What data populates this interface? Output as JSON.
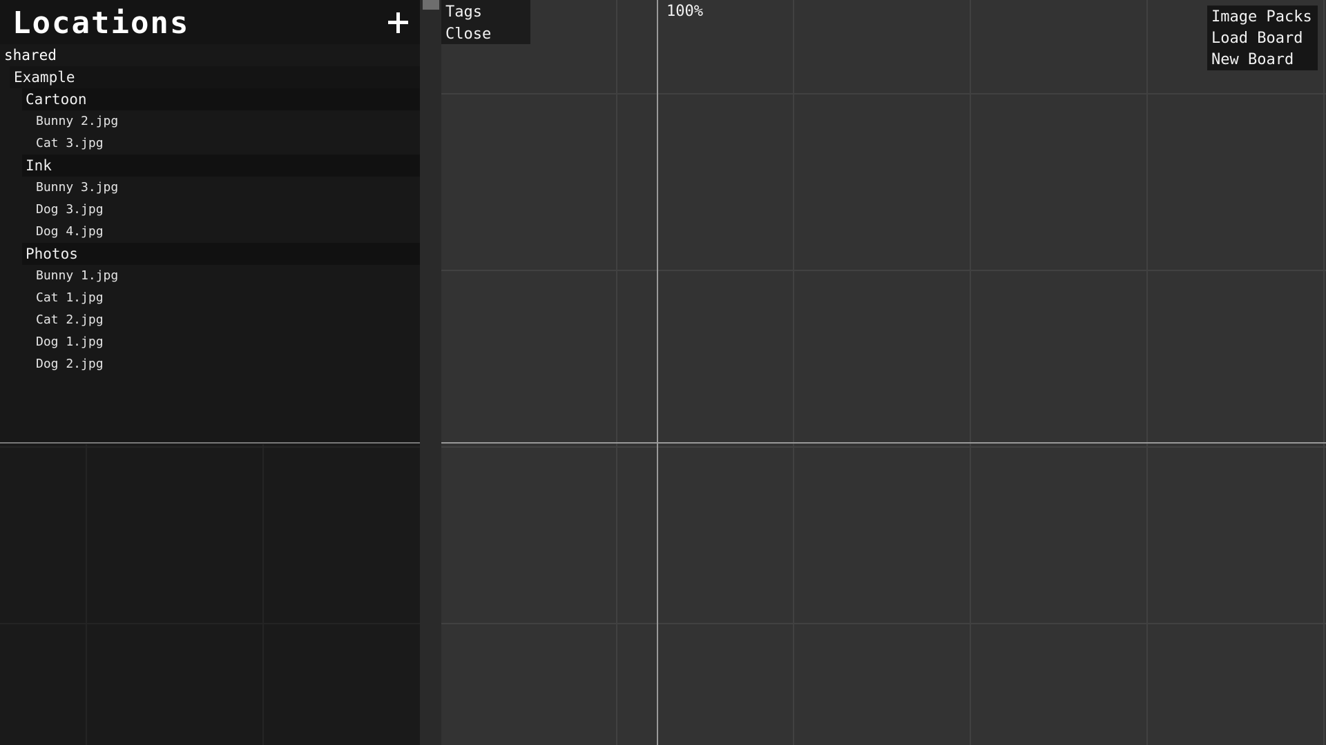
{
  "sidebar": {
    "title": "Locations",
    "add_label": "+",
    "tree": {
      "root": "shared",
      "group": "Example",
      "folders": [
        {
          "label": "Cartoon",
          "files": [
            "Bunny 2.jpg",
            "Cat 3.jpg"
          ]
        },
        {
          "label": "Ink",
          "files": [
            "Bunny 3.jpg",
            "Dog 3.jpg",
            "Dog 4.jpg"
          ]
        },
        {
          "label": "Photos",
          "files": [
            "Bunny 1.jpg",
            "Cat 1.jpg",
            "Cat 2.jpg",
            "Dog 1.jpg",
            "Dog 2.jpg"
          ]
        }
      ]
    }
  },
  "context_menu": {
    "items": [
      "Tags",
      "Close"
    ]
  },
  "canvas": {
    "zoom_label": "100%"
  },
  "board_menu": {
    "items": [
      "Image Packs",
      "Load Board",
      "New Board"
    ]
  },
  "colors": {
    "canvas_bg": "#333333",
    "sidebar_bg": "#1a1a1a",
    "axis": "#9a9a9a",
    "text": "#ffffff"
  }
}
